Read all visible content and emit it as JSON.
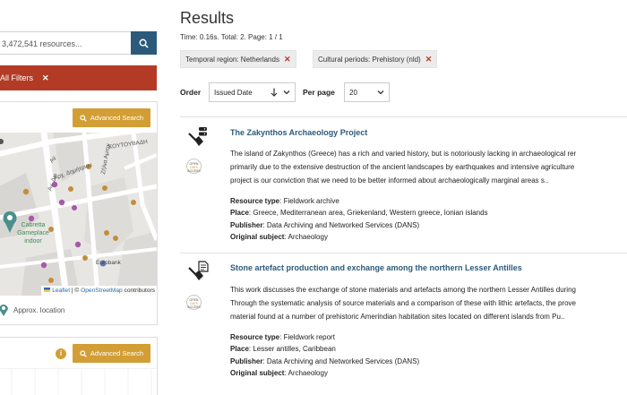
{
  "sidebar": {
    "search_placeholder": "3,472,541 resources...",
    "filters_label": "All Filters",
    "filters_clear": "✕",
    "advanced_search_label": "Advanced Search",
    "map": {
      "streets": [
        "Αγ.",
        "Αγ. Διο",
        "Αρχ. Δημήτριου",
        "Ζήλια Αμιτρι",
        "ΚΟΥΤΟΥΒΑΔΗ",
        "Cabretta Gameplace indoor",
        "Eurobank"
      ],
      "attribution_leaflet": "Leaflet",
      "attribution_sep": "| ©",
      "attribution_osm": "OpenStreetMap",
      "attribution_suffix": "contributors"
    },
    "approx_location_label": "Approx. location",
    "second_panel": {
      "info_icon": "i",
      "advanced_search_label": "Advanced Search"
    }
  },
  "results": {
    "title": "Results",
    "stats": "Time: 0.16s. Total: 2. Page: 1 / 1",
    "active_filters": [
      {
        "label": "Temporal region: Netherlands",
        "remove": "✕"
      },
      {
        "label": "Cultural periods: Prehistory (nld)",
        "remove": "✕"
      }
    ],
    "order_label": "Order",
    "order_value": "Issued Date",
    "per_page_label": "Per page",
    "per_page_value": "20",
    "items": [
      {
        "title": "The Zakynthos Archaeology Project",
        "description": "The island of Zakynthos (Greece) has a rich and varied history, but is notoriously lacking in archaeological rer\nprimarily due to the extensive destruction of the ancient landscapes by earthquakes and intensive agriculture\nproject is our conviction that we need to be better informed about archaeologically marginal areas s..",
        "resource_type_label": "Resource type",
        "resource_type": "Fieldwork archive",
        "place_label": "Place",
        "place": "Greece, Mediterranean area, Griekenland, Western greece, Ionian islands",
        "publisher_label": "Publisher",
        "publisher": "Data Archiving and Networked Services (DANS)",
        "subject_label": "Original subject",
        "subject": "Archaeology",
        "badge_line1": "OPEN",
        "badge_line2": "DATA",
        "badge_line3": "ACCESS"
      },
      {
        "title": "Stone artefact production and exchange among the northern Lesser Antilles",
        "description": "This work discusses the exchange of stone materials and artefacts among the northern Lesser Antilles during\nThrough the systematic analysis of source materials and a comparison of these with lithic artefacts, the prove\nmaterial found at a number of prehistoric Amerindian habitation sites located on different islands from Pu..",
        "resource_type_label": "Resource type",
        "resource_type": "Fieldwork report",
        "place_label": "Place",
        "place": "Lesser antilles, Caribbean",
        "publisher_label": "Publisher",
        "publisher": "Data Archiving and Networked Services (DANS)",
        "subject_label": "Original subject",
        "subject": "Archaeology",
        "badge_line1": "OPEN",
        "badge_line2": "DATA",
        "badge_line3": "ACCESS"
      }
    ]
  },
  "colors": {
    "primary": "#2c5a7a",
    "danger": "#b33b26",
    "accent": "#d39e35"
  }
}
